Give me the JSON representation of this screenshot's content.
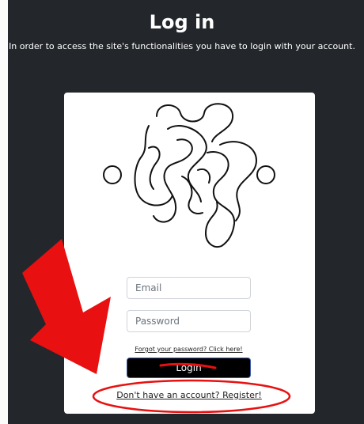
{
  "header": {
    "title": "Log in",
    "subtitle": "In order to access the site's functionalities you have to login with your account."
  },
  "form": {
    "email_placeholder": "Email",
    "password_placeholder": "Password",
    "forgot_link": "Forgot your password? Click here!",
    "login_label": "Login",
    "register_link": "Don't have an account? Register!"
  },
  "colors": {
    "background": "#23272b",
    "card": "#ffffff",
    "button": "#000000",
    "annotation": "#e81010"
  },
  "icons": {
    "logo": "node-network-logo-icon",
    "annotation_arrow": "red-arrow-icon"
  }
}
